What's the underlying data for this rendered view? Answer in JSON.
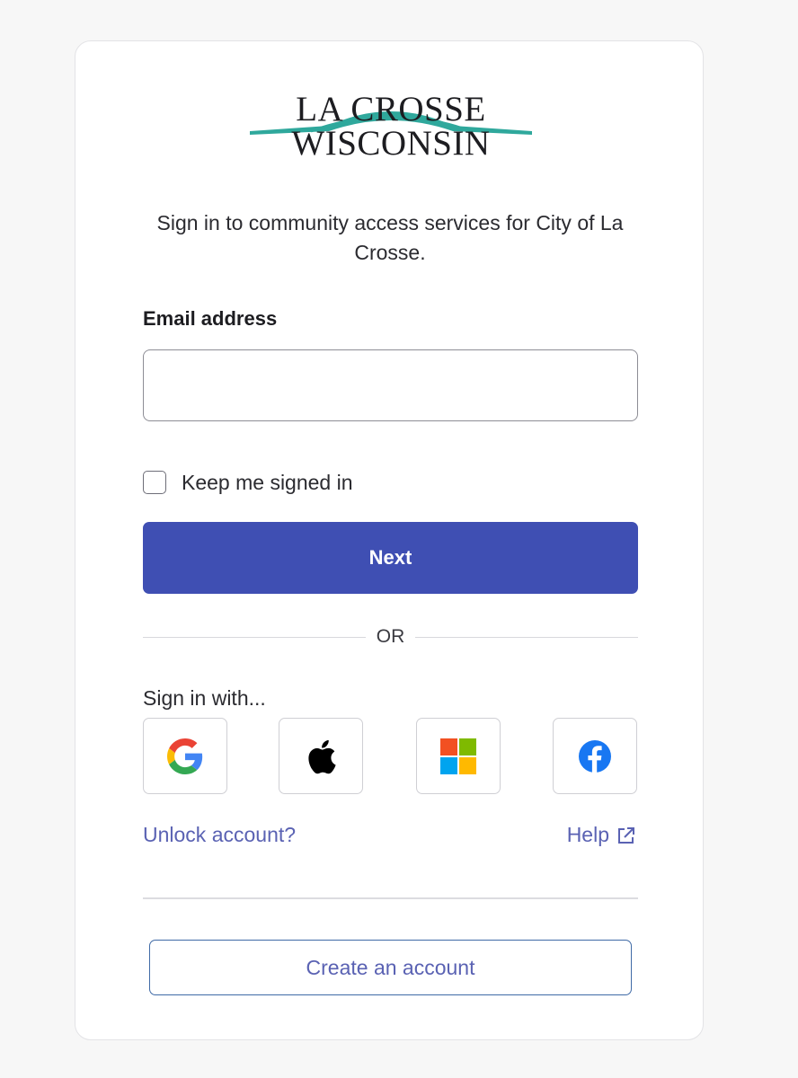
{
  "logo": {
    "line1": "LA CROSSE",
    "line2": "WISCONSIN",
    "accent_color": "#2fa89c"
  },
  "intro_text": "Sign in to community access services for City of La Crosse.",
  "email": {
    "label": "Email address",
    "value": "",
    "placeholder": ""
  },
  "keep_signed_in": {
    "label": "Keep me signed in",
    "checked": false
  },
  "next_button": {
    "label": "Next",
    "color": "#3f4fb3"
  },
  "separator": "OR",
  "social": {
    "heading": "Sign in with...",
    "providers": [
      {
        "name": "google",
        "icon": "google-icon"
      },
      {
        "name": "apple",
        "icon": "apple-icon"
      },
      {
        "name": "microsoft",
        "icon": "microsoft-icon"
      },
      {
        "name": "facebook",
        "icon": "facebook-icon"
      }
    ]
  },
  "links": {
    "unlock": "Unlock account?",
    "help": "Help",
    "help_icon": "external-link-icon",
    "color": "#5a62b3"
  },
  "create_account": {
    "label": "Create an account"
  }
}
